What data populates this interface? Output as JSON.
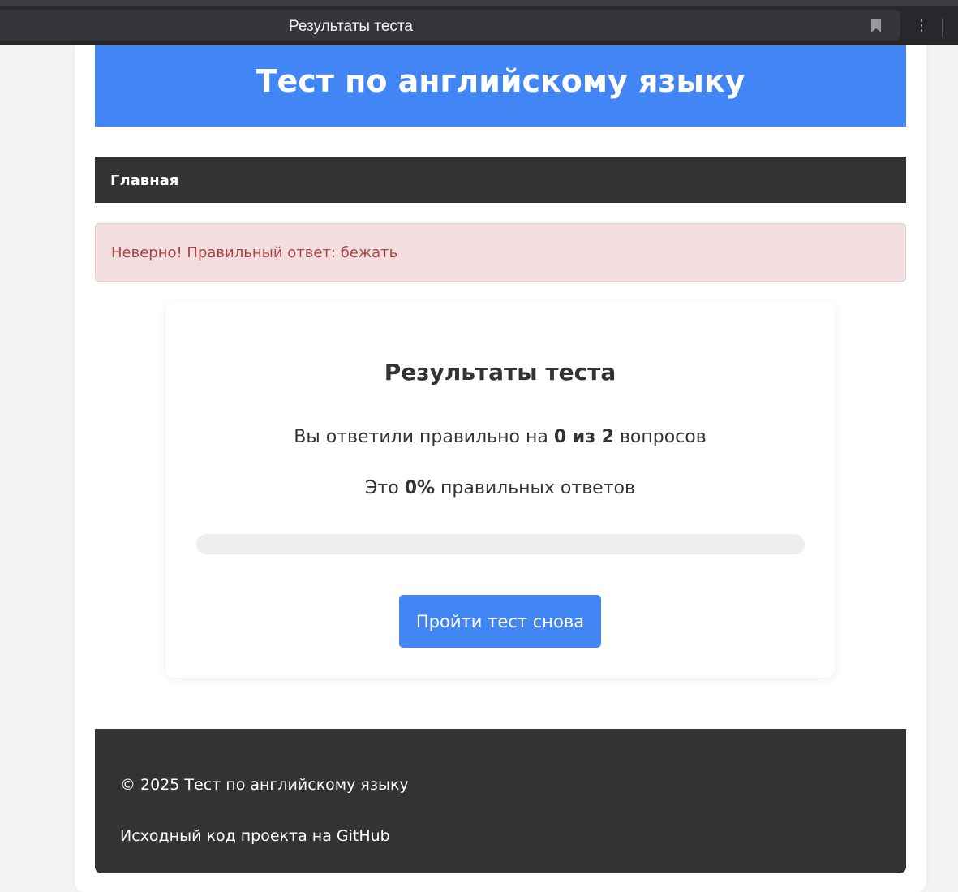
{
  "browser": {
    "tab_title": "Результаты теста",
    "menu_glyph": "⋮"
  },
  "header": {
    "title": "Тест по английскому языку"
  },
  "nav": {
    "home_label": "Главная"
  },
  "alert": {
    "message": "Неверно! Правильный ответ: бежать"
  },
  "results": {
    "title": "Результаты теста",
    "score_prefix": "Вы ответили правильно на ",
    "score_value": "0 из 2",
    "score_suffix": " вопросов",
    "percent_prefix": "Это ",
    "percent_value": "0%",
    "percent_suffix": " правильных ответов",
    "progress_percent": 0,
    "retry_label": "Пройти тест снова"
  },
  "footer": {
    "copyright": "© 2025 Тест по английскому языку",
    "source_link": "Исходный код проекта на GitHub"
  },
  "colors": {
    "accent": "#4285f4",
    "dark": "#333333",
    "alert_bg": "#f2dedf",
    "alert_text": "#a94442"
  }
}
